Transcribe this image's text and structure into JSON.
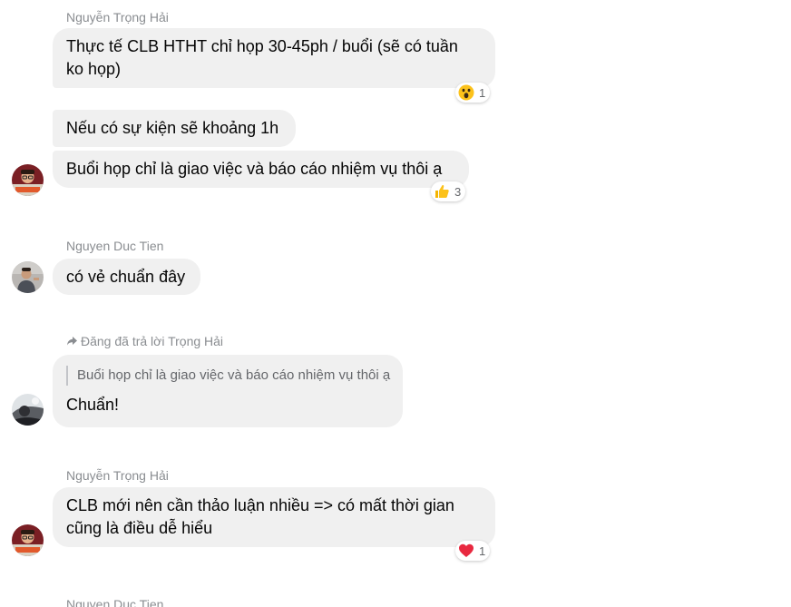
{
  "messages": [
    {
      "sender": "Nguyễn Trọng Hải",
      "lines": [
        "Thực tế CLB HTHT chỉ họp 30-45ph / buổi (sẽ có tuần",
        "ko họp)"
      ],
      "reaction": {
        "icon": "wow-emoji-icon",
        "count": "1"
      }
    },
    {
      "lines": [
        "Nếu có sự kiện sẽ khoảng 1h"
      ]
    },
    {
      "lines": [
        "Buổi họp chỉ là giao việc và báo cáo nhiệm vụ thôi ạ"
      ],
      "reaction": {
        "icon": "thumbs-up-icon",
        "count": "3"
      }
    },
    {
      "sender": "Nguyen Duc Tien",
      "lines": [
        "có vẻ chuẩn đây"
      ]
    },
    {
      "reply_header": "Đăng đã trả lời Trọng Hải",
      "quoted_text": "Buổi họp chỉ là giao việc và báo cáo nhiệm vụ thôi ạ",
      "lines": [
        "Chuẩn!"
      ]
    },
    {
      "sender": "Nguyễn Trọng Hải",
      "lines": [
        "CLB mới nên cần thảo luận nhiều => có mất thời gian",
        "cũng là điều dễ hiểu"
      ],
      "reaction": {
        "icon": "heart-icon",
        "count": "1"
      }
    },
    {
      "sender": "Nguyen Duc Tien"
    }
  ],
  "colors": {
    "bubble": "#f0f0f0",
    "sender_text": "#8a8d91",
    "message_text": "#050505",
    "reaction_count": "#65676b"
  }
}
